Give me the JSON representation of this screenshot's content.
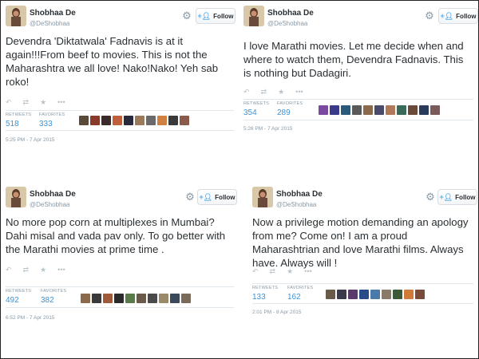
{
  "colors": {
    "link": "#3b94d9",
    "muted": "#8899a6",
    "follow_icon": "#55acee",
    "text": "#292f33"
  },
  "tweets": [
    {
      "name": "Shobhaa De",
      "handle": "@DeShobhaa",
      "follow_label": "Follow",
      "text": "Devendra 'Diktatwala' Fadnavis is at it again!!!From beef to movies. This is not the Maharashtra we all love! Nako!Nako! Yeh sab roko!",
      "retweets_label": "RETWEETS",
      "retweets": "518",
      "favorites_label": "FAVORITES",
      "favorites": "333",
      "time": "5:25 PM - 7 Apr 2015",
      "avatar_colors": [
        "#5a4a3a",
        "#8a3a2a",
        "#3a2a2a",
        "#c0603a",
        "#2a2a3a",
        "#9a7a5a",
        "#6a6a6a",
        "#d08040",
        "#3a3a3a",
        "#8a5a4a"
      ]
    },
    {
      "name": "Shobhaa De",
      "handle": "@DeShobhaa",
      "follow_label": "Follow",
      "text": "I love Marathi movies. Let me decide when and where to watch them, Devendra Fadnavis. This is nothing but Dadagiri.",
      "retweets_label": "RETWEETS",
      "retweets": "354",
      "favorites_label": "FAVORITES",
      "favorites": "289",
      "time": "5:26 PM - 7 Apr 2015",
      "avatar_colors": [
        "#7a4aa0",
        "#3a3a8a",
        "#2a5a7a",
        "#5a5a5a",
        "#8a6a4a",
        "#4a4a6a",
        "#b07a5a",
        "#3a6a5a",
        "#6a4a3a",
        "#2a3a5a",
        "#7a5a5a"
      ]
    },
    {
      "name": "Shobhaa De",
      "handle": "@DeShobhaa",
      "follow_label": "Follow",
      "text": "No more pop corn at multiplexes in Mumbai? Dahi misal and vada pav only. To go better with the Marathi movies at prime time .",
      "retweets_label": "RETWEETS",
      "retweets": "492",
      "favorites_label": "FAVORITES",
      "favorites": "382",
      "time": "6:52 PM - 7 Apr 2015",
      "avatar_colors": [
        "#8a6a4a",
        "#3a3a3a",
        "#a05a3a",
        "#2a2a2a",
        "#5a7a4a",
        "#6a5a4a",
        "#4a4a4a",
        "#9a8a6a",
        "#3a4a5a",
        "#7a6a5a"
      ]
    },
    {
      "name": "Shobhaa De",
      "handle": "@DeShobhaa",
      "follow_label": "Follow",
      "text": "Now a privilege motion demanding an apology from me? Come on! I am a proud Maharashtrian and love Marathi films. Always have. Always will !",
      "retweets_label": "RETWEETS",
      "retweets": "133",
      "favorites_label": "FAVORITES",
      "favorites": "162",
      "time": "2:01 PM - 8 Apr 2015",
      "avatar_colors": [
        "#6a5a4a",
        "#3a3a4a",
        "#5a3a6a",
        "#2a4a8a",
        "#4a7aaa",
        "#8a7a6a",
        "#3a5a3a",
        "#d07a3a",
        "#7a4a3a"
      ]
    }
  ]
}
